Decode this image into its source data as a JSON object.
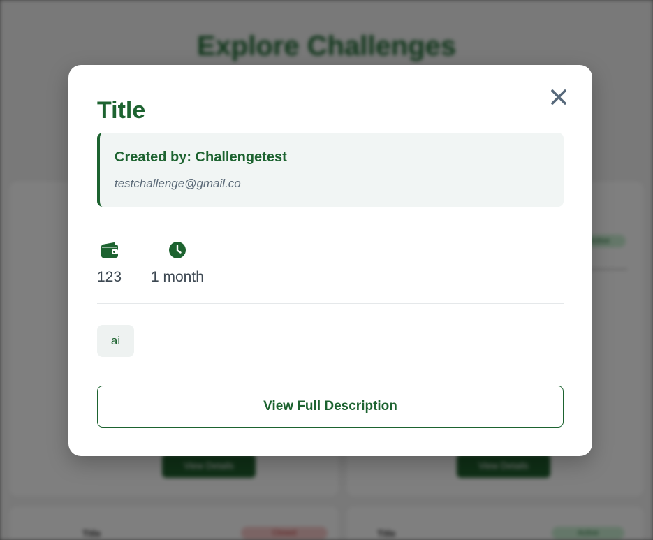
{
  "background": {
    "page_title": "Explore Challenges",
    "card_button_label": "View Details",
    "status_active": "Active",
    "status_closed": "Closed",
    "card_titles": [
      "Title",
      "Title"
    ]
  },
  "modal": {
    "title": "Title",
    "creator_label": "Created by: Challengetest",
    "creator_email": "testchallenge@gmail.co",
    "reward_icon": "wallet-icon",
    "reward_value": "123",
    "duration_icon": "clock-icon",
    "duration_value": "1 month",
    "tags": [
      "ai"
    ],
    "view_button_label": "View Full Description",
    "close_icon": "close-icon"
  },
  "colors": {
    "primary_green": "#1d6330",
    "text_gray": "#3d4852",
    "email_gray": "#5b6a78",
    "creator_bg": "#f1f5f4",
    "close_gray": "#56687a"
  }
}
